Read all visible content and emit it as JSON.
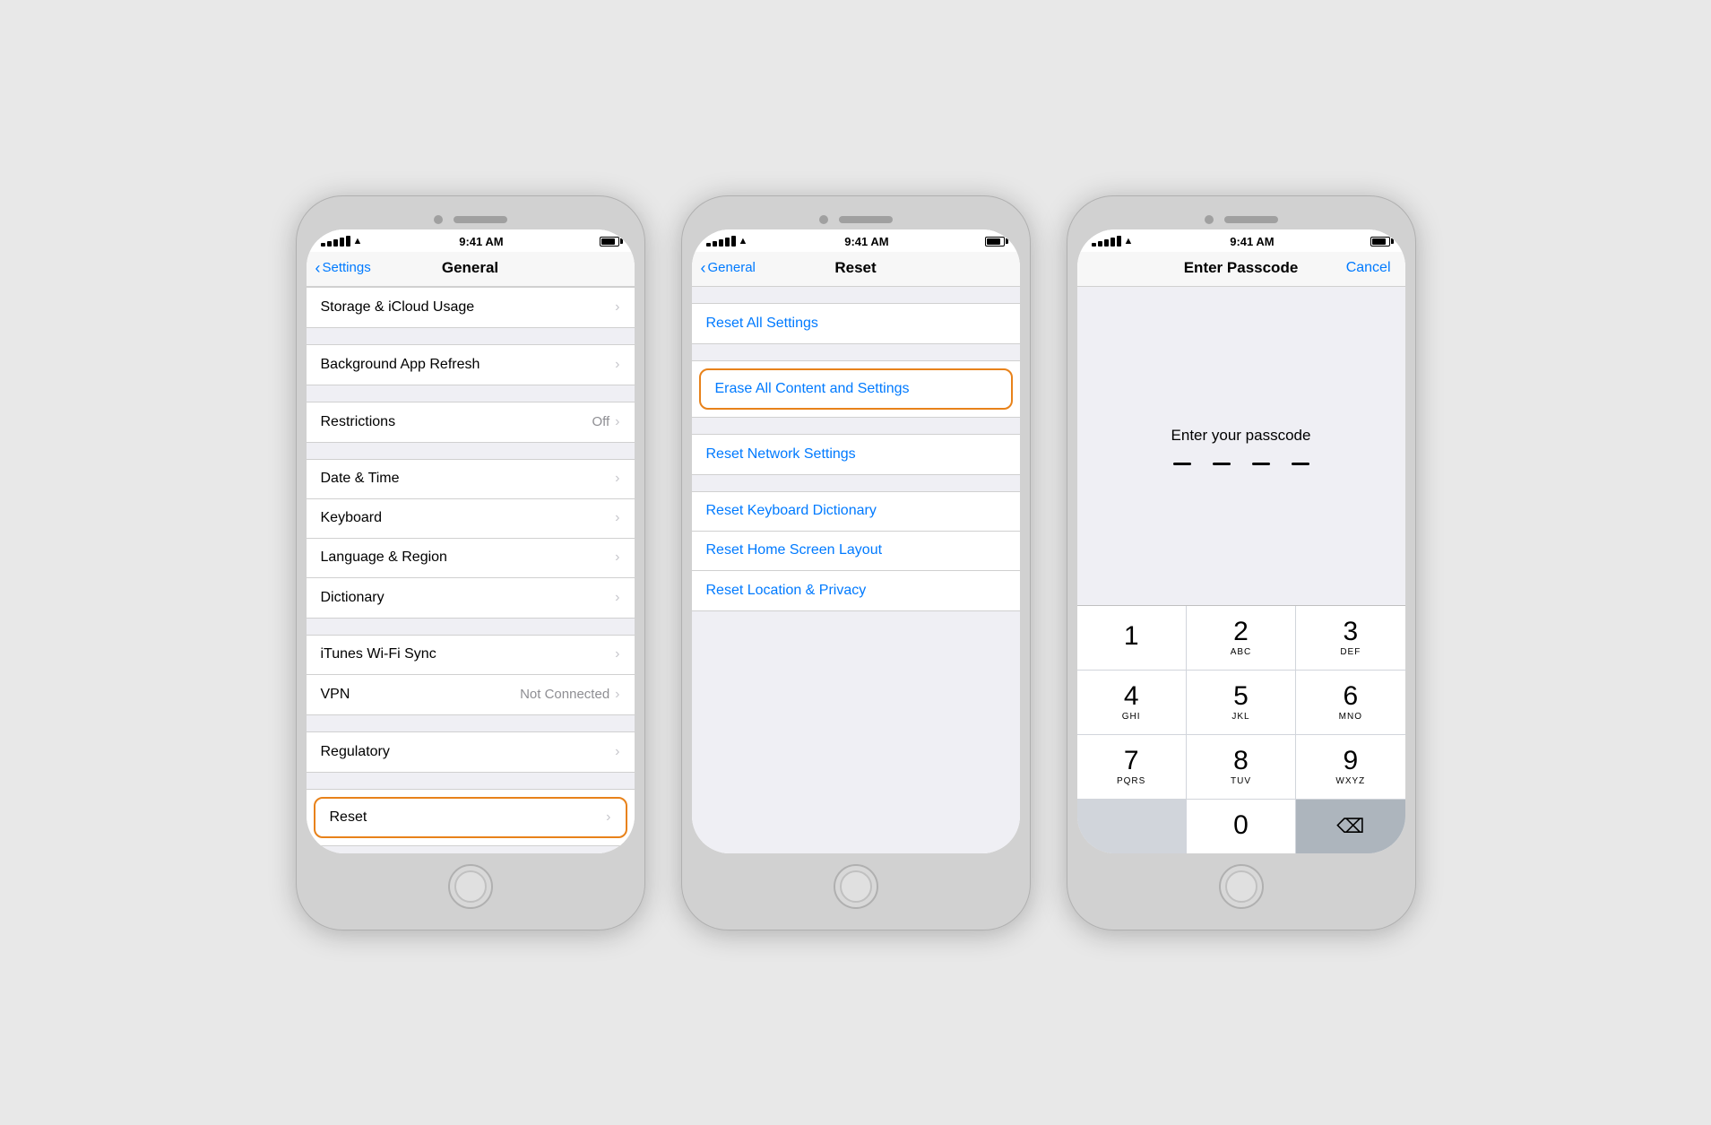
{
  "phone1": {
    "status": {
      "time": "9:41 AM",
      "signal": [
        3,
        4,
        5,
        6,
        7
      ],
      "wifi": "wifi",
      "battery": "battery"
    },
    "nav": {
      "back_label": "Settings",
      "title": "General"
    },
    "items": [
      {
        "label": "Storage & iCloud Usage",
        "value": "",
        "chevron": true,
        "group": 1
      },
      {
        "label": "Background App Refresh",
        "value": "",
        "chevron": true,
        "group": 2
      },
      {
        "label": "Restrictions",
        "value": "Off",
        "chevron": true,
        "group": 3
      },
      {
        "label": "Date & Time",
        "value": "",
        "chevron": true,
        "group": 4
      },
      {
        "label": "Keyboard",
        "value": "",
        "chevron": true,
        "group": 4
      },
      {
        "label": "Language & Region",
        "value": "",
        "chevron": true,
        "group": 4
      },
      {
        "label": "Dictionary",
        "value": "",
        "chevron": true,
        "group": 4
      },
      {
        "label": "iTunes Wi-Fi Sync",
        "value": "",
        "chevron": true,
        "group": 5
      },
      {
        "label": "VPN",
        "value": "Not Connected",
        "chevron": true,
        "group": 5
      },
      {
        "label": "Regulatory",
        "value": "",
        "chevron": true,
        "group": 6
      },
      {
        "label": "Reset",
        "value": "",
        "chevron": true,
        "group": 7,
        "highlighted": true
      }
    ]
  },
  "phone2": {
    "status": {
      "time": "9:41 AM"
    },
    "nav": {
      "back_label": "General",
      "title": "Reset"
    },
    "items": [
      {
        "label": "Reset All Settings",
        "blue": true,
        "group": 1
      },
      {
        "label": "Erase All Content and Settings",
        "blue": true,
        "group": 2,
        "highlighted": true
      },
      {
        "label": "Reset Network Settings",
        "blue": true,
        "group": 3
      },
      {
        "label": "Reset Keyboard Dictionary",
        "blue": true,
        "group": 4
      },
      {
        "label": "Reset Home Screen Layout",
        "blue": true,
        "group": 4
      },
      {
        "label": "Reset Location & Privacy",
        "blue": true,
        "group": 4
      }
    ]
  },
  "phone3": {
    "status": {
      "time": "9:41 AM"
    },
    "nav": {
      "title": "Enter Passcode",
      "action": "Cancel"
    },
    "passcode": {
      "prompt": "Enter your passcode",
      "dots": [
        "—",
        "—",
        "—",
        "—"
      ]
    },
    "numpad": [
      {
        "num": "1",
        "letters": ""
      },
      {
        "num": "2",
        "letters": "ABC"
      },
      {
        "num": "3",
        "letters": "DEF"
      },
      {
        "num": "4",
        "letters": "GHI"
      },
      {
        "num": "5",
        "letters": "JKL"
      },
      {
        "num": "6",
        "letters": "MNO"
      },
      {
        "num": "7",
        "letters": "PQRS"
      },
      {
        "num": "8",
        "letters": "TUV"
      },
      {
        "num": "9",
        "letters": "WXYZ"
      },
      {
        "num": "",
        "letters": "",
        "type": "empty"
      },
      {
        "num": "0",
        "letters": ""
      },
      {
        "num": "⌫",
        "letters": "",
        "type": "delete"
      }
    ]
  }
}
